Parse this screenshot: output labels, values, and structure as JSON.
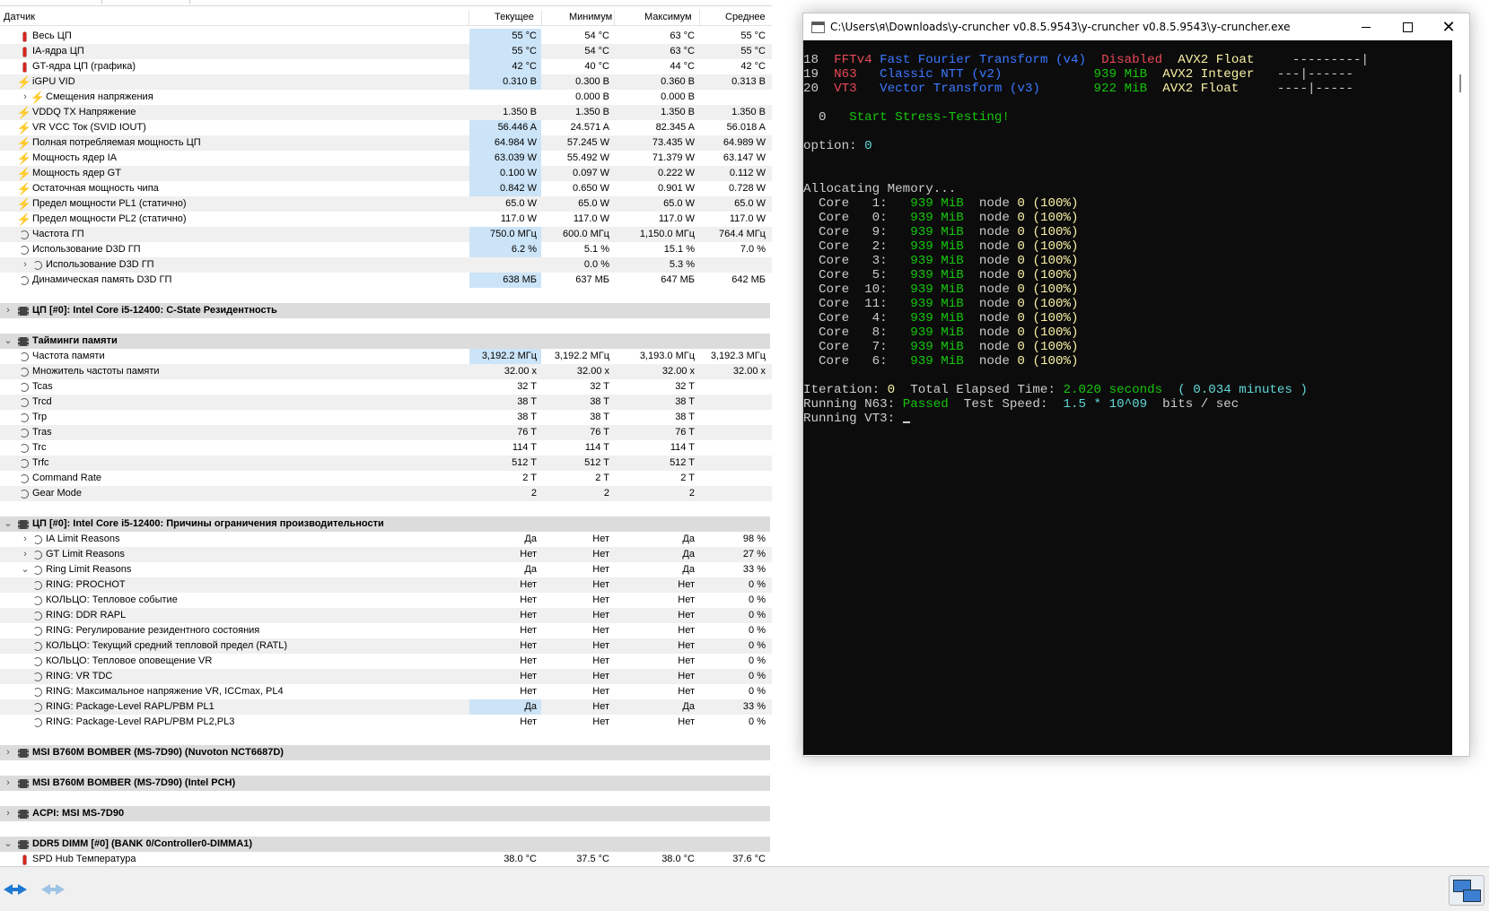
{
  "sensor": {
    "headers": [
      "Датчик",
      "Текущее",
      "Минимум",
      "Максимум",
      "Среднее"
    ],
    "rows": [
      {
        "type": "item",
        "indent": 1,
        "icon": "thermo",
        "label": "Весь ЦП",
        "v": [
          "55 °C",
          "54 °C",
          "63 °C",
          "55 °C"
        ],
        "hl": true
      },
      {
        "type": "item",
        "indent": 1,
        "icon": "thermo",
        "label": "IA-ядра ЦП",
        "v": [
          "55 °C",
          "54 °C",
          "63 °C",
          "55 °C"
        ],
        "hl": true
      },
      {
        "type": "item",
        "indent": 1,
        "icon": "thermo",
        "label": "GT-ядра ЦП (графика)",
        "v": [
          "42 °C",
          "40 °C",
          "44 °C",
          "42 °C"
        ],
        "hl": true
      },
      {
        "type": "item",
        "indent": 1,
        "icon": "bolt",
        "label": "iGPU VID",
        "v": [
          "0.310 В",
          "0.300 В",
          "0.360 В",
          "0.313 В"
        ],
        "hl": true
      },
      {
        "type": "item",
        "indent": 2,
        "icon": "bolt",
        "label": "Смещения напряжения",
        "v": [
          "",
          "0.000 В",
          "0.000 В",
          ""
        ],
        "expand": "›"
      },
      {
        "type": "item",
        "indent": 1,
        "icon": "bolt",
        "label": "VDDQ TX Напряжение",
        "v": [
          "1.350 В",
          "1.350 В",
          "1.350 В",
          "1.350 В"
        ]
      },
      {
        "type": "item",
        "indent": 1,
        "icon": "bolt",
        "label": "VR VCC Ток (SVID IOUT)",
        "v": [
          "56.446 A",
          "24.571 A",
          "82.345 A",
          "56.018 A"
        ],
        "hl": true
      },
      {
        "type": "item",
        "indent": 1,
        "icon": "bolt",
        "label": "Полная потребляемая мощность ЦП",
        "v": [
          "64.984 W",
          "57.245 W",
          "73.435 W",
          "64.989 W"
        ],
        "hl": true
      },
      {
        "type": "item",
        "indent": 1,
        "icon": "bolt",
        "label": "Мощность ядер IA",
        "v": [
          "63.039 W",
          "55.492 W",
          "71.379 W",
          "63.147 W"
        ],
        "hl": true
      },
      {
        "type": "item",
        "indent": 1,
        "icon": "bolt",
        "label": "Мощность ядер GT",
        "v": [
          "0.100 W",
          "0.097 W",
          "0.222 W",
          "0.112 W"
        ],
        "hl": true
      },
      {
        "type": "item",
        "indent": 1,
        "icon": "bolt",
        "label": "Остаточная мощность чипа",
        "v": [
          "0.842 W",
          "0.650 W",
          "0.901 W",
          "0.728 W"
        ],
        "hl": true
      },
      {
        "type": "item",
        "indent": 1,
        "icon": "bolt",
        "label": "Предел мощности PL1 (статично)",
        "v": [
          "65.0 W",
          "65.0 W",
          "65.0 W",
          "65.0 W"
        ]
      },
      {
        "type": "item",
        "indent": 1,
        "icon": "bolt",
        "label": "Предел мощности PL2 (статично)",
        "v": [
          "117.0 W",
          "117.0 W",
          "117.0 W",
          "117.0 W"
        ]
      },
      {
        "type": "item",
        "indent": 1,
        "icon": "clock",
        "label": "Частота ГП",
        "v": [
          "750.0 МГц",
          "600.0 МГц",
          "1,150.0 МГц",
          "764.4 МГц"
        ],
        "hl": true
      },
      {
        "type": "item",
        "indent": 1,
        "icon": "clock",
        "label": "Использование D3D ГП",
        "v": [
          "6.2 %",
          "5.1 %",
          "15.1 %",
          "7.0 %"
        ],
        "hl": true
      },
      {
        "type": "item",
        "indent": 2,
        "icon": "clock",
        "label": "Использование D3D ГП",
        "v": [
          "",
          "0.0 %",
          "5.3 %",
          ""
        ],
        "expand": "›"
      },
      {
        "type": "item",
        "indent": 1,
        "icon": "clock",
        "label": "Динамическая память D3D ГП",
        "v": [
          "638 МБ",
          "637 МБ",
          "647 МБ",
          "642 МБ"
        ],
        "hl": true
      },
      {
        "type": "spacer"
      },
      {
        "type": "group",
        "label": "ЦП [#0]: Intel Core i5-12400: C-State Резидентность",
        "expand": "›"
      },
      {
        "type": "spacer"
      },
      {
        "type": "group",
        "label": "Тайминги памяти",
        "expand": "⌄"
      },
      {
        "type": "item",
        "indent": 1,
        "icon": "clock",
        "label": "Частота памяти",
        "v": [
          "3,192.2 МГц",
          "3,192.2 МГц",
          "3,193.0 МГц",
          "3,192.3 МГц"
        ],
        "hl": true
      },
      {
        "type": "item",
        "indent": 1,
        "icon": "clock",
        "label": "Множитель частоты памяти",
        "v": [
          "32.00 x",
          "32.00 x",
          "32.00 x",
          "32.00 x"
        ]
      },
      {
        "type": "item",
        "indent": 1,
        "icon": "clock",
        "label": "Tcas",
        "v": [
          "32 T",
          "32 T",
          "32 T",
          ""
        ]
      },
      {
        "type": "item",
        "indent": 1,
        "icon": "clock",
        "label": "Trcd",
        "v": [
          "38 T",
          "38 T",
          "38 T",
          ""
        ]
      },
      {
        "type": "item",
        "indent": 1,
        "icon": "clock",
        "label": "Trp",
        "v": [
          "38 T",
          "38 T",
          "38 T",
          ""
        ]
      },
      {
        "type": "item",
        "indent": 1,
        "icon": "clock",
        "label": "Tras",
        "v": [
          "76 T",
          "76 T",
          "76 T",
          ""
        ]
      },
      {
        "type": "item",
        "indent": 1,
        "icon": "clock",
        "label": "Trc",
        "v": [
          "114 T",
          "114 T",
          "114 T",
          ""
        ]
      },
      {
        "type": "item",
        "indent": 1,
        "icon": "clock",
        "label": "Trfc",
        "v": [
          "512 T",
          "512 T",
          "512 T",
          ""
        ]
      },
      {
        "type": "item",
        "indent": 1,
        "icon": "clock",
        "label": "Command Rate",
        "v": [
          "2 T",
          "2 T",
          "2 T",
          ""
        ]
      },
      {
        "type": "item",
        "indent": 1,
        "icon": "clock",
        "label": "Gear Mode",
        "v": [
          "2",
          "2",
          "2",
          ""
        ]
      },
      {
        "type": "spacer"
      },
      {
        "type": "group",
        "label": "ЦП [#0]: Intel Core i5-12400: Причины ограничения производительности",
        "expand": "⌄"
      },
      {
        "type": "item",
        "indent": 2,
        "icon": "clock",
        "label": "IA Limit Reasons",
        "v": [
          "Да",
          "Нет",
          "Да",
          "98 %"
        ],
        "expand": "›"
      },
      {
        "type": "item",
        "indent": 2,
        "icon": "clock",
        "label": "GT Limit Reasons",
        "v": [
          "Нет",
          "Нет",
          "Да",
          "27 %"
        ],
        "expand": "›"
      },
      {
        "type": "item",
        "indent": 2,
        "icon": "clock",
        "label": "Ring Limit Reasons",
        "v": [
          "Да",
          "Нет",
          "Да",
          "33 %"
        ],
        "expand": "⌄"
      },
      {
        "type": "item",
        "indent": 2,
        "icon": "clock",
        "label": "RING: PROCHOT",
        "v": [
          "Нет",
          "Нет",
          "Нет",
          "0 %"
        ]
      },
      {
        "type": "item",
        "indent": 2,
        "icon": "clock",
        "label": "КОЛЬЦО: Тепловое событие",
        "v": [
          "Нет",
          "Нет",
          "Нет",
          "0 %"
        ]
      },
      {
        "type": "item",
        "indent": 2,
        "icon": "clock",
        "label": "RING: DDR RAPL",
        "v": [
          "Нет",
          "Нет",
          "Нет",
          "0 %"
        ]
      },
      {
        "type": "item",
        "indent": 2,
        "icon": "clock",
        "label": "RING: Регулирование резидентного состояния",
        "v": [
          "Нет",
          "Нет",
          "Нет",
          "0 %"
        ]
      },
      {
        "type": "item",
        "indent": 2,
        "icon": "clock",
        "label": "КОЛЬЦО: Текущий средний тепловой предел (RATL)",
        "v": [
          "Нет",
          "Нет",
          "Нет",
          "0 %"
        ]
      },
      {
        "type": "item",
        "indent": 2,
        "icon": "clock",
        "label": "КОЛЬЦО: Тепловое оповещение VR",
        "v": [
          "Нет",
          "Нет",
          "Нет",
          "0 %"
        ]
      },
      {
        "type": "item",
        "indent": 2,
        "icon": "clock",
        "label": "RING: VR TDC",
        "v": [
          "Нет",
          "Нет",
          "Нет",
          "0 %"
        ]
      },
      {
        "type": "item",
        "indent": 2,
        "icon": "clock",
        "label": "RING: Максимальное напряжение VR, ICCmax, PL4",
        "v": [
          "Нет",
          "Нет",
          "Нет",
          "0 %"
        ]
      },
      {
        "type": "item",
        "indent": 2,
        "icon": "clock",
        "label": "RING: Package-Level RAPL/PBM PL1",
        "v": [
          "Да",
          "Нет",
          "Да",
          "33 %"
        ],
        "hl": true
      },
      {
        "type": "item",
        "indent": 2,
        "icon": "clock",
        "label": "RING: Package-Level RAPL/PBM PL2,PL3",
        "v": [
          "Нет",
          "Нет",
          "Нет",
          "0 %"
        ]
      },
      {
        "type": "spacer"
      },
      {
        "type": "group",
        "label": "MSI B760M BOMBER (MS-7D90) (Nuvoton NCT6687D)",
        "expand": "›"
      },
      {
        "type": "spacer"
      },
      {
        "type": "group",
        "label": "MSI B760M BOMBER (MS-7D90) (Intel PCH)",
        "expand": "›"
      },
      {
        "type": "spacer"
      },
      {
        "type": "group",
        "label": "ACPI: MSI MS-7D90",
        "expand": "›"
      },
      {
        "type": "spacer"
      },
      {
        "type": "group",
        "label": "DDR5 DIMM [#0] (BANK 0/Controller0-DIMMA1)",
        "expand": "⌄"
      },
      {
        "type": "item",
        "indent": 1,
        "icon": "thermo",
        "label": "SPD Hub Температура",
        "v": [
          "38.0 °C",
          "37.5 °C",
          "38.0 °C",
          "37.6 °C"
        ]
      }
    ]
  },
  "console": {
    "title": "C:\\Users\\я\\Downloads\\y-cruncher v0.8.5.9543\\y-cruncher v0.8.5.9543\\y-cruncher.exe",
    "close_glyph": "✕",
    "lines": [
      [
        {
          "t": "18  ",
          "c": "w"
        },
        {
          "t": "FFTv4",
          "c": "r"
        },
        {
          "t": " Fast Fourier Transform (v4)  ",
          "c": "b"
        },
        {
          "t": "Disabled",
          "c": "r"
        },
        {
          "t": "  ",
          "c": "w"
        },
        {
          "t": "AVX2 Float",
          "c": "y"
        },
        {
          "t": "     ---------|",
          "c": "w"
        }
      ],
      [
        {
          "t": "19  ",
          "c": "w"
        },
        {
          "t": "N63  ",
          "c": "r"
        },
        {
          "t": " Classic NTT (v2)           ",
          "c": "b"
        },
        {
          "t": " 939 MiB",
          "c": "g"
        },
        {
          "t": "  ",
          "c": "w"
        },
        {
          "t": "AVX2 Integer",
          "c": "ly"
        },
        {
          "t": "   ---|------",
          "c": "w"
        }
      ],
      [
        {
          "t": "20  ",
          "c": "w"
        },
        {
          "t": "VT3  ",
          "c": "r"
        },
        {
          "t": " Vector Transform (v3)      ",
          "c": "b"
        },
        {
          "t": " 922 MiB",
          "c": "g"
        },
        {
          "t": "  ",
          "c": "w"
        },
        {
          "t": "AVX2 Float",
          "c": "y"
        },
        {
          "t": "     ----|-----",
          "c": "w"
        }
      ],
      [],
      [
        {
          "t": "  0   ",
          "c": "w"
        },
        {
          "t": "Start Stress-Testing!",
          "c": "g"
        }
      ],
      [],
      [
        {
          "t": "option: ",
          "c": "w"
        },
        {
          "t": "0",
          "c": "c"
        }
      ],
      [],
      [],
      [
        {
          "t": "Allocating Memory...",
          "c": "w"
        }
      ],
      [
        {
          "t": "  Core   1:   ",
          "c": "w"
        },
        {
          "t": "939 MiB",
          "c": "g"
        },
        {
          "t": "  node ",
          "c": "w"
        },
        {
          "t": "0",
          "c": "y"
        },
        {
          "t": " (100%)",
          "c": "y"
        }
      ],
      [
        {
          "t": "  Core   0:   ",
          "c": "w"
        },
        {
          "t": "939 MiB",
          "c": "g"
        },
        {
          "t": "  node ",
          "c": "w"
        },
        {
          "t": "0",
          "c": "y"
        },
        {
          "t": " (100%)",
          "c": "y"
        }
      ],
      [
        {
          "t": "  Core   9:   ",
          "c": "w"
        },
        {
          "t": "939 MiB",
          "c": "g"
        },
        {
          "t": "  node ",
          "c": "w"
        },
        {
          "t": "0",
          "c": "y"
        },
        {
          "t": " (100%)",
          "c": "y"
        }
      ],
      [
        {
          "t": "  Core   2:   ",
          "c": "w"
        },
        {
          "t": "939 MiB",
          "c": "g"
        },
        {
          "t": "  node ",
          "c": "w"
        },
        {
          "t": "0",
          "c": "y"
        },
        {
          "t": " (100%)",
          "c": "y"
        }
      ],
      [
        {
          "t": "  Core   3:   ",
          "c": "w"
        },
        {
          "t": "939 MiB",
          "c": "g"
        },
        {
          "t": "  node ",
          "c": "w"
        },
        {
          "t": "0",
          "c": "y"
        },
        {
          "t": " (100%)",
          "c": "y"
        }
      ],
      [
        {
          "t": "  Core   5:   ",
          "c": "w"
        },
        {
          "t": "939 MiB",
          "c": "g"
        },
        {
          "t": "  node ",
          "c": "w"
        },
        {
          "t": "0",
          "c": "y"
        },
        {
          "t": " (100%)",
          "c": "y"
        }
      ],
      [
        {
          "t": "  Core  10:   ",
          "c": "w"
        },
        {
          "t": "939 MiB",
          "c": "g"
        },
        {
          "t": "  node ",
          "c": "w"
        },
        {
          "t": "0",
          "c": "y"
        },
        {
          "t": " (100%)",
          "c": "y"
        }
      ],
      [
        {
          "t": "  Core  11:   ",
          "c": "w"
        },
        {
          "t": "939 MiB",
          "c": "g"
        },
        {
          "t": "  node ",
          "c": "w"
        },
        {
          "t": "0",
          "c": "y"
        },
        {
          "t": " (100%)",
          "c": "y"
        }
      ],
      [
        {
          "t": "  Core   4:   ",
          "c": "w"
        },
        {
          "t": "939 MiB",
          "c": "g"
        },
        {
          "t": "  node ",
          "c": "w"
        },
        {
          "t": "0",
          "c": "y"
        },
        {
          "t": " (100%)",
          "c": "y"
        }
      ],
      [
        {
          "t": "  Core   8:   ",
          "c": "w"
        },
        {
          "t": "939 MiB",
          "c": "g"
        },
        {
          "t": "  node ",
          "c": "w"
        },
        {
          "t": "0",
          "c": "y"
        },
        {
          "t": " (100%)",
          "c": "y"
        }
      ],
      [
        {
          "t": "  Core   7:   ",
          "c": "w"
        },
        {
          "t": "939 MiB",
          "c": "g"
        },
        {
          "t": "  node ",
          "c": "w"
        },
        {
          "t": "0",
          "c": "y"
        },
        {
          "t": " (100%)",
          "c": "y"
        }
      ],
      [
        {
          "t": "  Core   6:   ",
          "c": "w"
        },
        {
          "t": "939 MiB",
          "c": "g"
        },
        {
          "t": "  node ",
          "c": "w"
        },
        {
          "t": "0",
          "c": "y"
        },
        {
          "t": " (100%)",
          "c": "y"
        }
      ],
      [],
      [
        {
          "t": "Iteration: ",
          "c": "w"
        },
        {
          "t": "0",
          "c": "y"
        },
        {
          "t": "  Total Elapsed Time: ",
          "c": "w"
        },
        {
          "t": "2.020 seconds",
          "c": "g"
        },
        {
          "t": "  ( 0.034 minutes )",
          "c": "c"
        }
      ],
      [
        {
          "t": "Running N63: ",
          "c": "w"
        },
        {
          "t": "Passed",
          "c": "g"
        },
        {
          "t": "  Test Speed:  ",
          "c": "w"
        },
        {
          "t": "1.5 * 10^09",
          "c": "c"
        },
        {
          "t": "  bits / sec",
          "c": "w"
        }
      ],
      [
        {
          "t": "Running VT3: ",
          "c": "w"
        },
        {
          "t": "",
          "c": "cursor"
        }
      ]
    ]
  },
  "colors": {
    "highlight": "#cce4f7",
    "console_bg": "#0c0c0c",
    "group_band": "#dcdcdc",
    "arrow": "#1f78d1"
  },
  "icons": {
    "temperature": "thermometer-icon",
    "voltage": "lightning-icon",
    "clock": "clock-icon",
    "group": "chip-icon",
    "prev": "arrow-left-right-icon",
    "next": "arrow-left-right-disabled-icon",
    "network": "network-monitor-icon"
  }
}
